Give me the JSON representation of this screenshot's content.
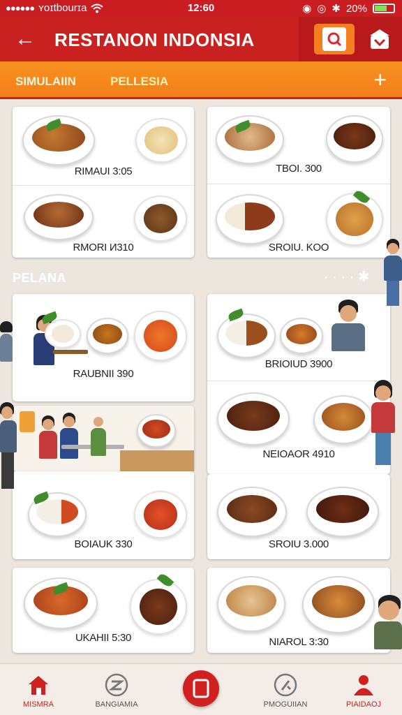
{
  "status": {
    "carrier": "ʏoɪtbourɪa",
    "time": "12:60",
    "battery": "20%"
  },
  "header": {
    "title": "RESTANON INDONSIA",
    "back": "←"
  },
  "tabs": [
    {
      "label": "SIMULAIIN"
    },
    {
      "label": "PELLESIA"
    }
  ],
  "tabs_add": "+",
  "section": {
    "title": "PELANA"
  },
  "menu": [
    {
      "label": "RIMAUI 3:05"
    },
    {
      "label": "TBOI. 300"
    },
    {
      "label": "RMORI И310"
    },
    {
      "label": "SROIU. KOO"
    },
    {
      "label": "RAUBNII 390"
    },
    {
      "label": "BRIOIUD 3900"
    },
    {
      "label": "NEIOAOR 4910"
    },
    {
      "label": "BOIAUK 330"
    },
    {
      "label": "SROIU 3.000"
    },
    {
      "label": "UKAHII 5:30"
    },
    {
      "label": "NIAROL 3:30"
    }
  ],
  "nav": [
    {
      "label": "MISMRA"
    },
    {
      "label": "BANGIAMIA"
    },
    {
      "label": "PMOGUIIAN"
    },
    {
      "label": "PIAIDAOJ"
    }
  ],
  "colors": {
    "primary": "#c9211f",
    "accent": "#f57f20"
  }
}
